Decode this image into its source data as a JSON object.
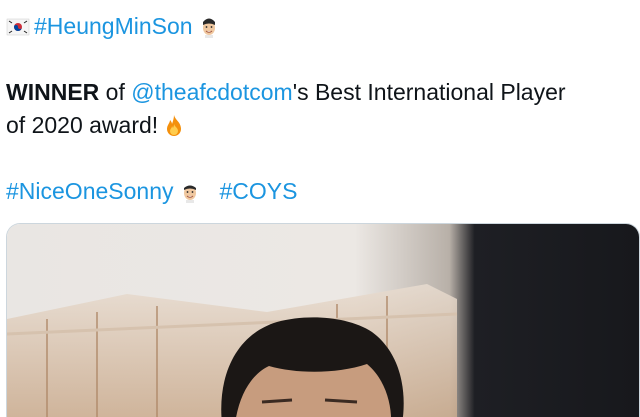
{
  "tweet": {
    "line1": {
      "flag_icon": "south-korea-flag-icon",
      "hashtag": "#HeungMinSon",
      "player_icon": "son-face-emoji-icon"
    },
    "line2": {
      "bold_word": "WINNER",
      "of_text": "of",
      "mention": "@theafcdotcom",
      "suffix": "'s Best International Player"
    },
    "line3": {
      "text": "of 2020 award!",
      "fire_icon": "fire-icon"
    },
    "line4": {
      "hashtag1": "#NiceOneSonny",
      "player_icon": "son-face-emoji-icon",
      "hashtag2": "#COYS"
    }
  },
  "media": {
    "type": "video-thumbnail",
    "description_icon": "video-frame"
  },
  "colors": {
    "link": "#1b95e0",
    "text": "#0f1419"
  }
}
